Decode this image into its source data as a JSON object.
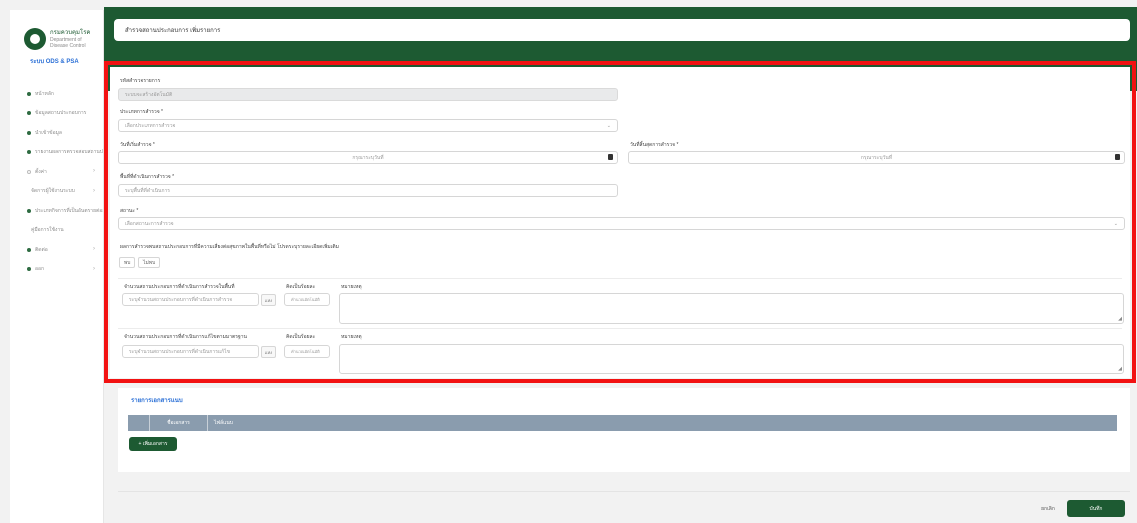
{
  "app": {
    "logo_text": "กรมควบคุมโรค",
    "logo_sub": "Department of Disease Control",
    "system_name": "ระบบ ODS & PSA",
    "header_title": "สำรวจสถานประกอบการ เพิ่มรายการ"
  },
  "sidebar": {
    "items": [
      {
        "label": "หน้าหลัก",
        "dot": true,
        "chevron": false
      },
      {
        "label": "ข้อมูลสถานประกอบการ",
        "dot": true,
        "chevron": false
      },
      {
        "label": "นำเข้าข้อมูล",
        "dot": true,
        "chevron": false
      },
      {
        "label": "รายงานผลการตรวจสอบสถานประกอบการ",
        "dot": true,
        "chevron": false
      },
      {
        "label": "ตั้งค่า",
        "dot": false,
        "chevron": true
      },
      {
        "label": "จัดการผู้ใช้งานระบบ",
        "dot": false,
        "chevron": true
      },
      {
        "label": "ประเภทกิจการที่เป็นอันตรายต่อสุขภาพ",
        "dot": true,
        "chevron": false
      },
      {
        "label": "คู่มือการใช้งาน",
        "dot": false,
        "chevron": false
      },
      {
        "label": "ติดต่อ",
        "dot": true,
        "chevron": true
      },
      {
        "label": "ออก",
        "dot": true,
        "chevron": true
      }
    ]
  },
  "form": {
    "code_label": "รหัสสำรวจรายการ",
    "code_value": "ระบบจะสร้างอัตโนมัติ",
    "type_label": "ประเภทการสำรวจ *",
    "type_value": "เลือกประเภทการสำรวจ",
    "start_label": "วันที่เริ่มสำรวจ *",
    "start_value": "กรุณาระบุวันที่",
    "end_label": "วันที่สิ้นสุดการสำรวจ *",
    "end_value": "กรุณาระบุวันที่",
    "area_label": "พื้นที่ที่ดำเนินการสำรวจ *",
    "area_placeholder": "ระบุพื้นที่ที่ดำเนินการ",
    "status_label": "สถานะ *",
    "status_value": "เลือกสถานะการสำรวจ",
    "question": "ผลการสำรวจพบสถานประกอบการที่มีความเสี่ยงต่อสุขภาพในพื้นที่หรือไม่ โปรดระบุรายละเอียดเพิ่มเติม",
    "radio_yes": "พบ",
    "radio_no": "ไม่พบ",
    "row1_label": "จำนวนสถานประกอบการที่ดำเนินการสำรวจในพื้นที่",
    "row1_value": "ระบุจำนวนสถานประกอบการที่ดำเนินการสำรวจ",
    "row1_unit": "แห่ง",
    "row2_label": "จำนวนสถานประกอบการที่ดำเนินการแก้ไขตามมาตรฐาน",
    "row2_value": "ระบุจำนวนสถานประกอบการที่ดำเนินการแก้ไข",
    "row2_unit": "แห่ง",
    "percent_label": "คิดเป็นร้อยละ",
    "percent_value": "คำนวณอัตโนมัติ",
    "remark_label": "หมายเหตุ"
  },
  "documents": {
    "title": "รายการเอกสารแนบ",
    "col_name": "ชื่อเอกสาร",
    "col_file": "ไฟล์แนบ",
    "add_label": "+ เพิ่มเอกสาร"
  },
  "footer": {
    "cancel_label": "ยกเลิก",
    "save_label": "บันทึก"
  },
  "colors": {
    "brand_green": "#1d5a32",
    "highlight_red": "#f21212",
    "link_blue": "#2a6fd6",
    "table_header": "#8a9cae"
  }
}
